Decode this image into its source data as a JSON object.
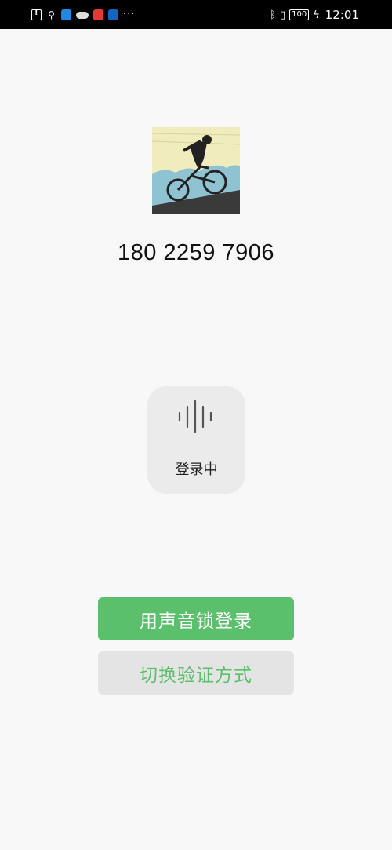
{
  "status_bar": {
    "left_icons": [
      "alert-doc-icon",
      "usb-icon",
      "search-app-icon",
      "cloud-icon",
      "red-app-icon",
      "blue-app-icon",
      "more-icon"
    ],
    "right_icons": [
      "bluetooth-icon",
      "vibrate-icon",
      "battery-icon",
      "charging-icon"
    ],
    "battery": "100",
    "time": "12:01"
  },
  "profile": {
    "avatar_desc": "cyclist-silhouette",
    "phone_number": "180 2259 7906"
  },
  "voice": {
    "status_label": "登录中"
  },
  "buttons": {
    "primary_label": "用声音锁登录",
    "secondary_label": "切换验证方式"
  },
  "colors": {
    "accent_green": "#5bc06b",
    "secondary_bg": "#e4e4e4",
    "page_bg": "#f8f8f8"
  }
}
